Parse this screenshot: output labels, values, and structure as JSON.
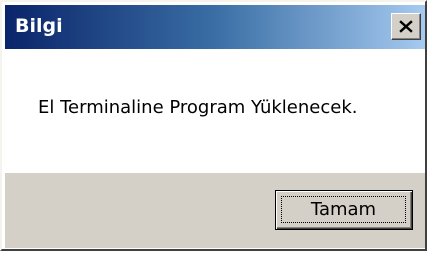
{
  "window": {
    "title": "Bilgi",
    "close_icon": "close-icon"
  },
  "message": {
    "text": "El Terminaline Program Yüklenecek."
  },
  "buttons": {
    "ok_label": "Tamam"
  }
}
